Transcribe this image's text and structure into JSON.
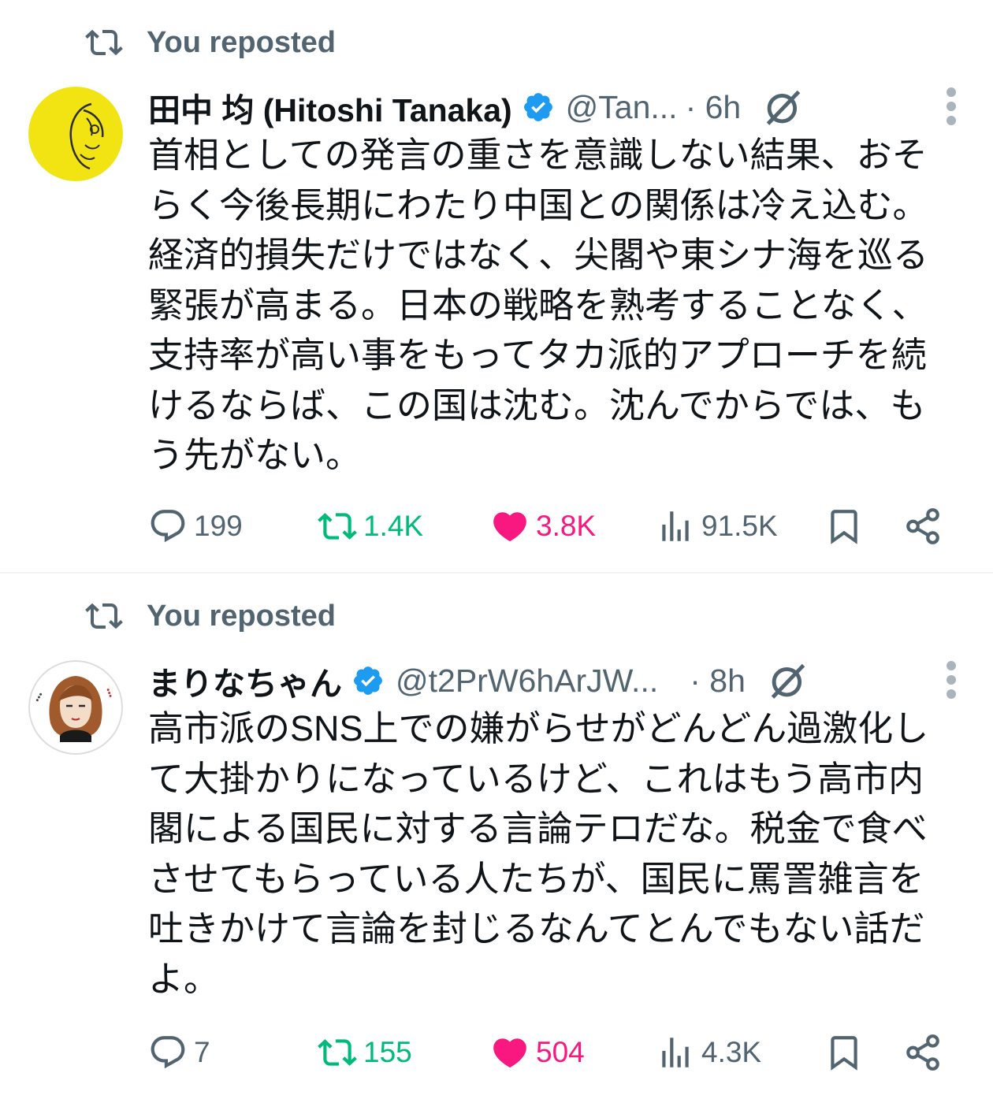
{
  "tweets": [
    {
      "repost_label": "You reposted",
      "name": "田中 均 (Hitoshi Tanaka)",
      "handle": "@Tan...",
      "time": "· 6h",
      "text": "首相としての発言の重さを意識しない結果、おそらく今後長期にわたり中国との関係は冷え込む。経済的損失だけではなく、尖閣や東シナ海を巡る緊張が高まる。日本の戦略を熟考することなく、支持率が高い事をもってタカ派的アプローチを続けるならば、この国は沈む。沈んでからでは、もう先がない。",
      "stats": {
        "replies": "199",
        "reposts": "1.4K",
        "likes": "3.8K",
        "views": "91.5K"
      },
      "reposted_by_me": true,
      "liked_by_me": true
    },
    {
      "repost_label": "You reposted",
      "name": "まりなちゃん",
      "handle": "@t2PrW6hArJW...",
      "time": "· 8h",
      "text": "高市派のSNS上での嫌がらせがどんどん過激化して大掛かりになっているけど、これはもう高市内閣による国民に対する言論テロだな。税金で食べさせてもらっている人たちが、国民に罵詈雑言を吐きかけて言論を封じるなんてとんでもない話だよ。",
      "stats": {
        "replies": "7",
        "reposts": "155",
        "likes": "504",
        "views": "4.3K"
      },
      "reposted_by_me": true,
      "liked_by_me": true
    }
  ],
  "colors": {
    "text": "#0f1419",
    "secondary": "#536471",
    "verified": "#1d9bf0",
    "repost_green": "#00ba7c",
    "like_pink": "#f91880",
    "divider": "#eff3f4"
  },
  "icons": [
    "repost-icon",
    "verified-badge-icon",
    "grok-icon",
    "more-icon",
    "reply-icon",
    "heart-icon",
    "views-icon",
    "bookmark-icon",
    "share-icon"
  ]
}
